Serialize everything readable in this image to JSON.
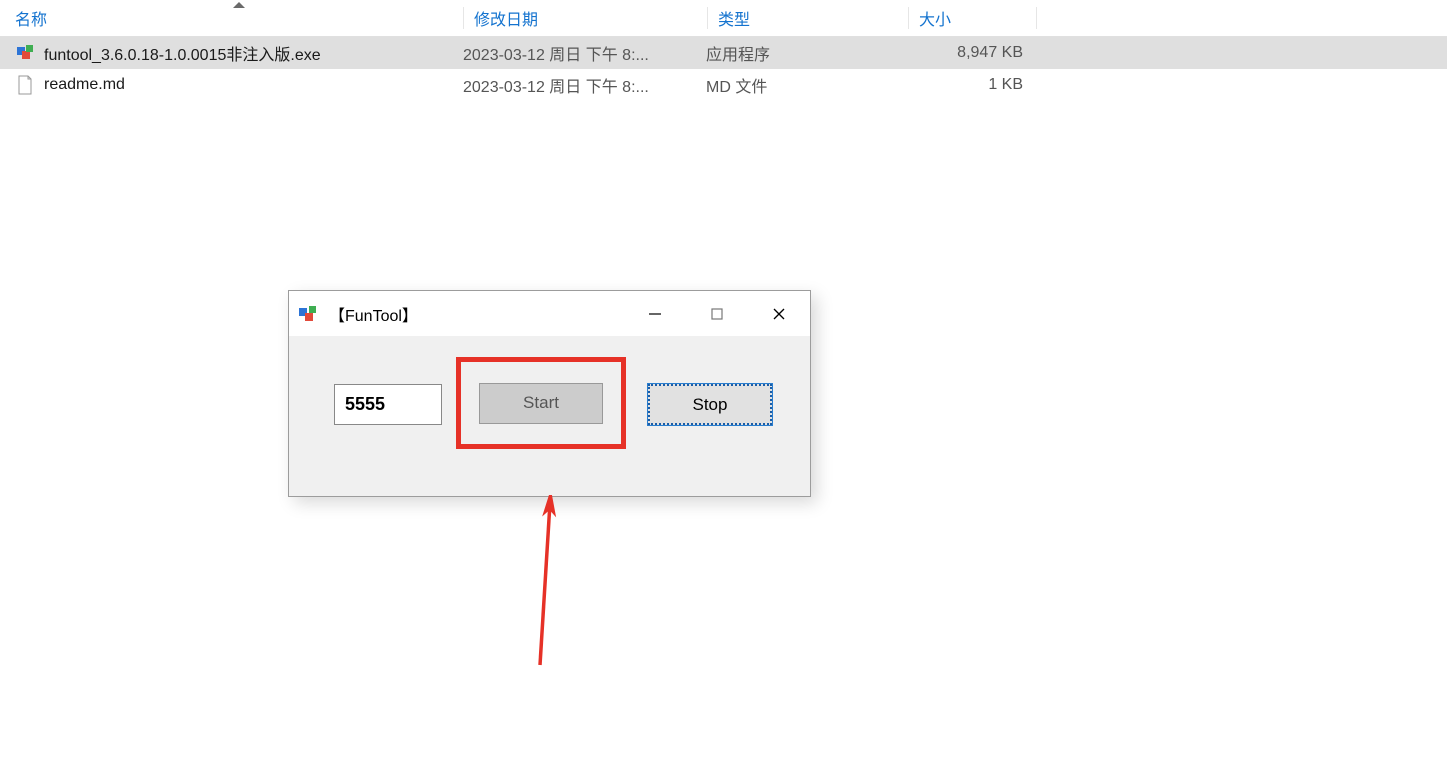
{
  "explorer": {
    "columns": {
      "name": "名称",
      "modified": "修改日期",
      "type": "类型",
      "size": "大小"
    },
    "files": [
      {
        "icon": "exe",
        "name": "funtool_3.6.0.18-1.0.0015非注入版.exe",
        "modified": "2023-03-12 周日 下午 8:...",
        "type": "应用程序",
        "size": "8,947 KB",
        "selected": true
      },
      {
        "icon": "md",
        "name": "readme.md",
        "modified": "2023-03-12 周日 下午 8:...",
        "type": "MD 文件",
        "size": "1 KB",
        "selected": false
      }
    ]
  },
  "dialog": {
    "title": "【FunTool】",
    "port_value": "5555",
    "start_label": "Start",
    "stop_label": "Stop"
  },
  "icons": {
    "app": "cubes-icon",
    "minimize": "minimize-icon",
    "maximize": "maximize-icon",
    "close": "close-icon",
    "sort": "sort-asc-icon"
  },
  "annotation": {
    "highlight_color": "#e63127",
    "arrow_color": "#e63127"
  }
}
